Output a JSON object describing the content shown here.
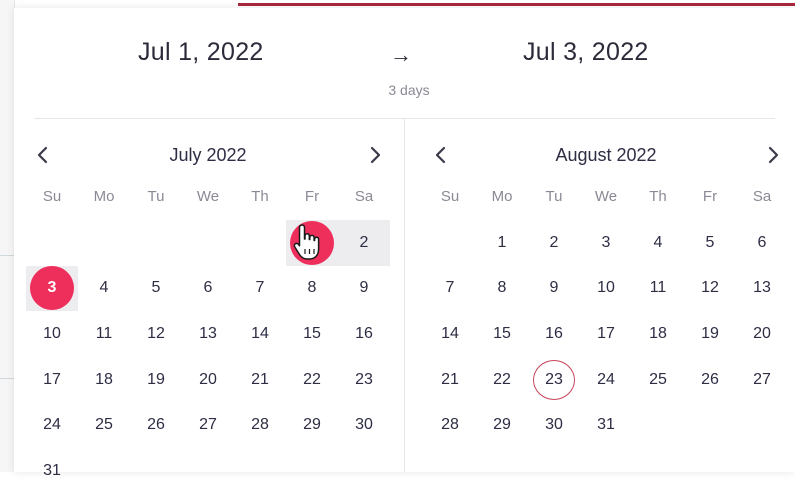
{
  "range": {
    "start": "Jul 1, 2022",
    "arrow": "→",
    "end": "Jul 3, 2022",
    "duration": "3 days"
  },
  "colors": {
    "accent": "#ee2f5b",
    "today_ring": "#c7455c",
    "range_fill": "#ededf0"
  },
  "weekdays": [
    "Su",
    "Mo",
    "Tu",
    "We",
    "Th",
    "Fr",
    "Sa"
  ],
  "months": [
    {
      "title": "July 2022",
      "leading_blanks": 5,
      "days": [
        "1",
        "2",
        "3",
        "4",
        "5",
        "6",
        "7",
        "8",
        "9",
        "10",
        "11",
        "12",
        "13",
        "14",
        "15",
        "16",
        "17",
        "18",
        "19",
        "20",
        "21",
        "22",
        "23",
        "24",
        "25",
        "26",
        "27",
        "28",
        "29",
        "30",
        "31"
      ],
      "selected": [
        "1",
        "3"
      ],
      "in_range": [
        "1",
        "2",
        "3"
      ],
      "today": null
    },
    {
      "title": "August 2022",
      "leading_blanks": 1,
      "days": [
        "1",
        "2",
        "3",
        "4",
        "5",
        "6",
        "7",
        "8",
        "9",
        "10",
        "11",
        "12",
        "13",
        "14",
        "15",
        "16",
        "17",
        "18",
        "19",
        "20",
        "21",
        "22",
        "23",
        "24",
        "25",
        "26",
        "27",
        "28",
        "29",
        "30",
        "31"
      ],
      "selected": [],
      "in_range": [],
      "today": "23"
    }
  ],
  "icons": {
    "prev": "chevron-left-icon",
    "next": "chevron-right-icon",
    "cursor": "hand-pointer-icon"
  }
}
